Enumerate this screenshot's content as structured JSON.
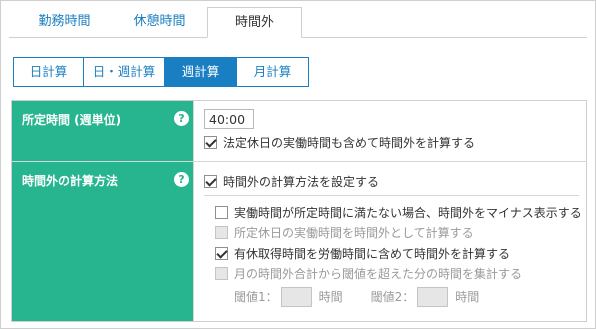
{
  "tabs": [
    {
      "label": "勤務時間",
      "active": false
    },
    {
      "label": "休憩時間",
      "active": false
    },
    {
      "label": "時間外",
      "active": true
    }
  ],
  "segments": [
    {
      "label": "日計算",
      "active": false
    },
    {
      "label": "日・週計算",
      "active": false
    },
    {
      "label": "週計算",
      "active": true
    },
    {
      "label": "月計算",
      "active": false
    }
  ],
  "row1": {
    "label": "所定時間 (週単位)",
    "help": "?",
    "time_value": "40:00",
    "option": {
      "label": "法定休日の実働時間も含めて時間外を計算する",
      "checked": true
    }
  },
  "row2": {
    "label": "時間外の計算方法",
    "help": "?",
    "main_option": {
      "label": "時間外の計算方法を設定する",
      "checked": true
    },
    "sub_options": [
      {
        "label": "実働時間が所定時間に満たない場合、時間外をマイナス表示する",
        "checked": false,
        "disabled": false
      },
      {
        "label": "所定休日の実働時間を時間外として計算する",
        "checked": false,
        "disabled": true
      },
      {
        "label": "有休取得時間を労働時間に含めて時間外を計算する",
        "checked": true,
        "disabled": false
      },
      {
        "label": "月の時間外合計から閾値を超えた分の時間を集計する",
        "checked": false,
        "disabled": true
      }
    ],
    "threshold1_label": "閾値1：",
    "threshold1_unit": "時間",
    "threshold2_label": "閾値2：",
    "threshold2_unit": "時間"
  }
}
